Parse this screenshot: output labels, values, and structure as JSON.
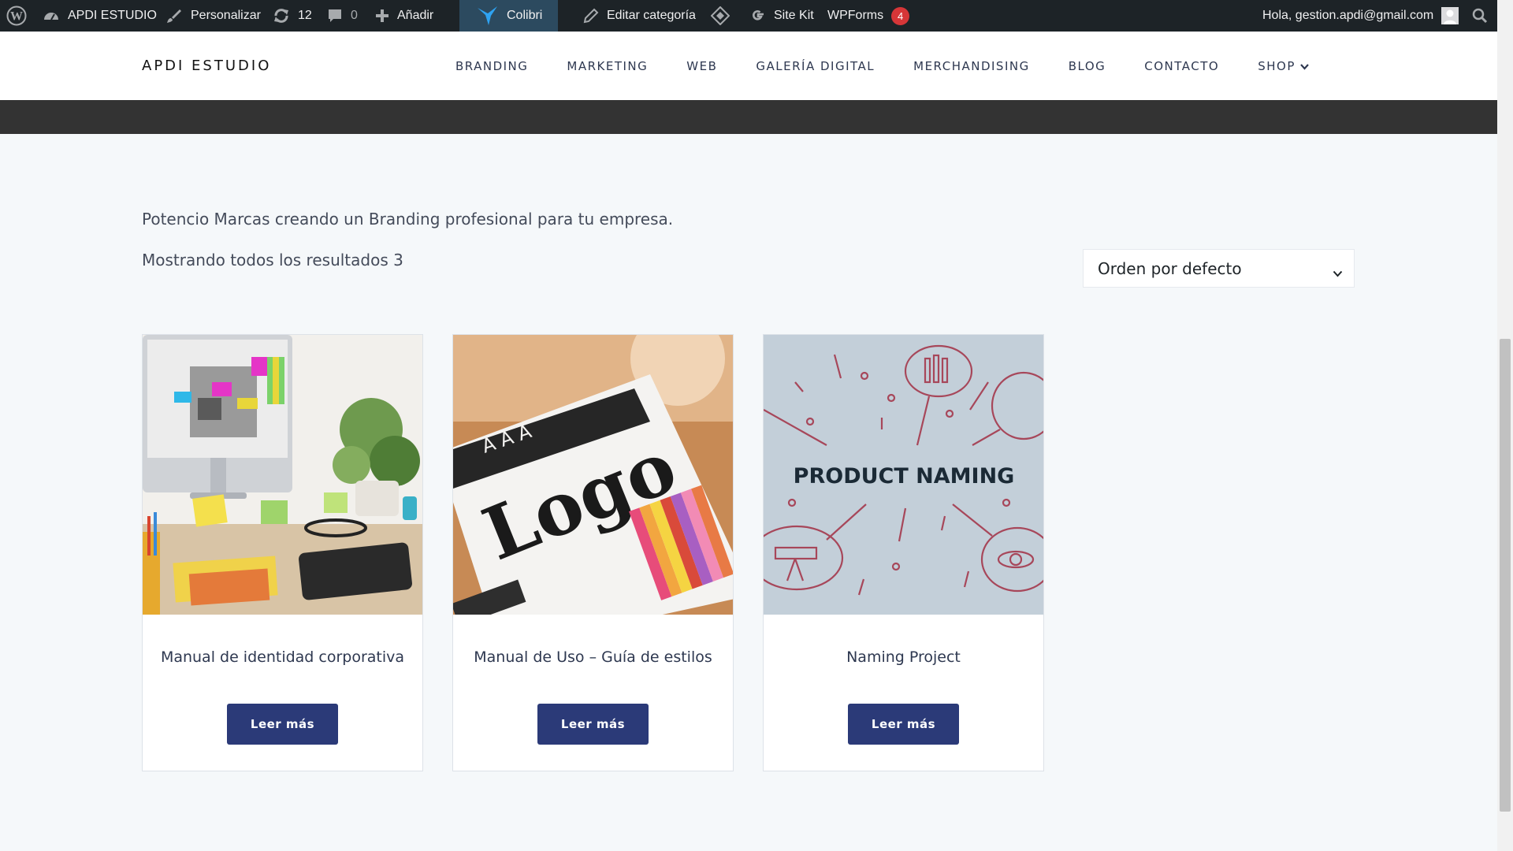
{
  "adminbar": {
    "site_name": "APDI ESTUDIO",
    "customize": "Personalizar",
    "updates_count": "12",
    "comments_count": "0",
    "add_new": "Añadir",
    "colibri": "Colibri",
    "edit_category": "Editar categoría",
    "site_kit": "Site Kit",
    "wpforms": "WPForms",
    "wpforms_badge": "4",
    "greeting": "Hola, gestion.apdi@gmail.com"
  },
  "header": {
    "logo": "APDI ESTUDIO",
    "nav": [
      "BRANDING",
      "MARKETING",
      "WEB",
      "GALERÍA DIGITAL",
      "MERCHANDISING",
      "BLOG",
      "CONTACTO",
      "SHOP"
    ]
  },
  "content": {
    "description": "Potencio Marcas creando un Branding profesional para tu empresa.",
    "result_count": "Mostrando todos los resultados 3",
    "ordering_selected": "Orden por defecto"
  },
  "products": [
    {
      "title": "Manual de identidad corporativa",
      "button": "Leer más"
    },
    {
      "title": "Manual de Uso – Guía de estilos",
      "button": "Leer más"
    },
    {
      "title": "Naming Project",
      "button": "Leer más",
      "image_text": "PRODUCT NAMING"
    }
  ],
  "colors": {
    "adminbar_bg": "#1d2327",
    "colibri_bg": "#2c4a5f",
    "button_bg": "#2b3a78",
    "page_bg": "#f5f8fa",
    "naming_bg": "#c3cfd9",
    "naming_line": "#a7475a"
  },
  "icons": [
    "wordpress-icon",
    "dashboard-icon",
    "brush-icon",
    "updates-icon",
    "comment-icon",
    "plus-icon",
    "colibri-icon",
    "pencil-icon",
    "diamond-icon",
    "google-icon",
    "avatar-icon",
    "search-icon",
    "chevron-down-icon"
  ]
}
